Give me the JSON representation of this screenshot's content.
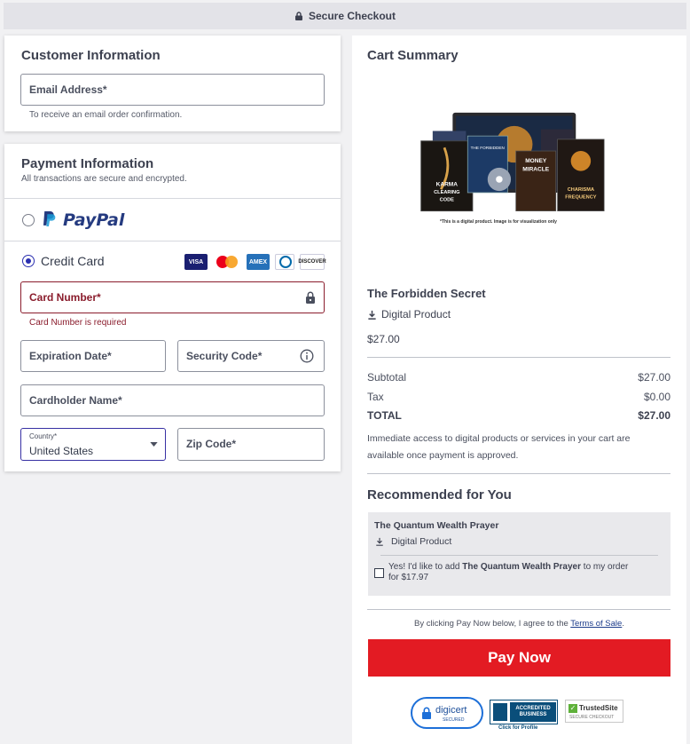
{
  "topbar": {
    "title": "Secure Checkout"
  },
  "customer": {
    "heading": "Customer Information",
    "email_label": "Email Address*",
    "email_helper": "To receive an email order confirmation."
  },
  "payment": {
    "heading": "Payment Information",
    "subheading": "All transactions are secure and encrypted.",
    "paypal_label": "PayPal",
    "credit_label": "Credit Card",
    "card_brands": [
      "VISA",
      "Mastercard",
      "AMEX",
      "Diners",
      "DISCOVER"
    ],
    "card_number_label": "Card Number*",
    "card_number_error": "Card Number is required",
    "expiration_label": "Expiration Date*",
    "security_label": "Security Code*",
    "cardholder_label": "Cardholder Name*",
    "country_label": "Country*",
    "country_value": "United States",
    "zip_label": "Zip Code*"
  },
  "cart": {
    "heading": "Cart Summary",
    "image_caption": "*This is a digital product. Image is for visualization only",
    "product_name": "The Forbidden Secret",
    "product_type": "Digital Product",
    "product_price": "$27.00",
    "subtotal_label": "Subtotal",
    "subtotal_value": "$27.00",
    "tax_label": "Tax",
    "tax_value": "$0.00",
    "total_label": "TOTAL",
    "total_value": "$27.00",
    "access_note": "Immediate access to digital products or services in your cart are available once payment is approved."
  },
  "recommended": {
    "heading": "Recommended for You",
    "item_name": "The Quantum Wealth Prayer",
    "item_type": "Digital Product",
    "offer_prefix": "Yes! I'd like to add ",
    "offer_product": "The Quantum Wealth Prayer",
    "offer_suffix": " to my order",
    "offer_price": "for $17.97"
  },
  "terms": {
    "prefix": "By clicking Pay Now below, I agree to the ",
    "link": "Terms of Sale",
    "suffix": "."
  },
  "pay_button": "Pay Now",
  "badges": {
    "digicert": "digicert",
    "digicert_sub": "SECURED",
    "bbb_line1": "ACCREDITED",
    "bbb_line2": "BUSINESS",
    "bbb_sub": "Click for Profile",
    "trusted": "TrustedSite",
    "trusted_sub": "SECURE CHECKOUT"
  },
  "book_covers": {
    "karma": "KARMA CLEARING CODE",
    "forbidden": "THE FORBIDDEN",
    "money": "MONEY MIRACLE",
    "charisma": "THE CHARISMA FREQUENCY"
  },
  "colors": {
    "pay_button": "#e31b23",
    "error": "#8a1c2c",
    "focus": "#3730a3",
    "radio": "#2a2fb0",
    "paypal_dark": "#253b80",
    "paypal_light": "#179bd7"
  }
}
